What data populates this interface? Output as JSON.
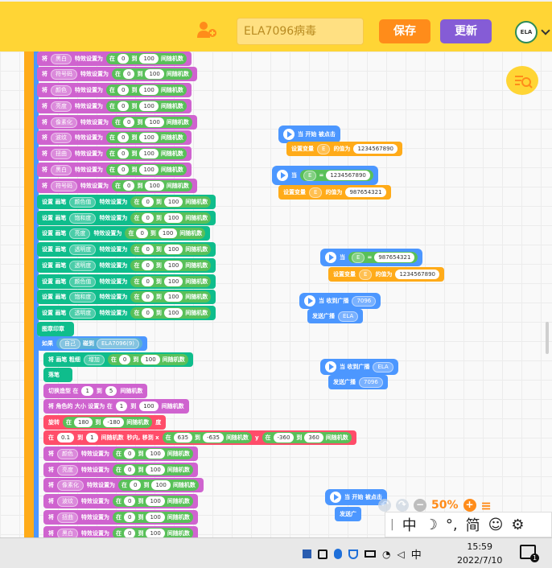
{
  "header": {
    "project_name": "ELA7096病毒",
    "save_label": "保存",
    "update_label": "更新",
    "logo_text": "ELA",
    "brand_color": "#ffd535"
  },
  "script_blocks": {
    "effect_set": "将",
    "effect_to": "特效设置为",
    "in": "在",
    "to": "到",
    "random": "间随机数",
    "effects": [
      "黑白",
      "符号码",
      "颜色",
      "亮度",
      "像素化",
      "波纹",
      "扭曲",
      "黑白",
      "符号码"
    ],
    "pen_set": "设置 画笔",
    "pen_props": [
      "颜色值",
      "饱和度",
      "亮度",
      "透明度",
      "透明度",
      "颜色值",
      "饱和度",
      "亮度",
      "透明度"
    ],
    "stamp": "图章印章",
    "if_label": "如果",
    "self_label": "自己",
    "touching": "碰到",
    "touch_target": "ELA7096(9)",
    "effect_increase_prefix": "将 画笔 粗细",
    "increase": "增加",
    "clear": "落笔",
    "switch_costume": "切换造型 在",
    "costume_a": "1",
    "costume_b": "5",
    "size_prefix": "将 角色的 大小 设置为 在",
    "size_a": "1",
    "size_b": "100",
    "rotate": "旋转",
    "rot_a": "180",
    "rot_b": "-180",
    "degree": "度",
    "glide_in": "在",
    "glide_a": "0.1",
    "glide_b": "1",
    "glide_text": "秒内, 移到 x",
    "x_a": "635",
    "x_b": "-635",
    "y_label": "y",
    "y_a": "-360",
    "y_b": "360",
    "lower_effects": [
      "颜色",
      "亮度",
      "像素化",
      "波纹",
      "扭曲",
      "黑白"
    ],
    "zero": "0",
    "hundred": "100"
  },
  "floating": {
    "hat1_title": "当 开始 被点击",
    "hat1_set": "设置变量",
    "var_name": "E",
    "value_label": "的值为",
    "val1": "1234567890",
    "hat2_when": "当",
    "hat2_cmp_val": "1234567890",
    "hat2_set_val": "987654321",
    "hat3_cmp_val": "987654321",
    "hat3_set_val": "1234567890",
    "recv1_title": "当 收到广播",
    "recv1_msg": "7096",
    "send1_label": "发送广播",
    "send1_msg": "ELA",
    "recv2_msg": "ELA",
    "send2_msg": "7096",
    "hat4_title": "当 开始 被点击",
    "send4_label": "发送广"
  },
  "zoom": {
    "percent": "50%"
  },
  "ime": {
    "mode": "中",
    "moon": "☽",
    "punct": "°,",
    "simp": "简",
    "emoji": "☺",
    "gear": "⚙"
  },
  "taskbar": {
    "lang": "中",
    "time": "15:59",
    "date": "2022/7/10",
    "notif_count": "1"
  }
}
